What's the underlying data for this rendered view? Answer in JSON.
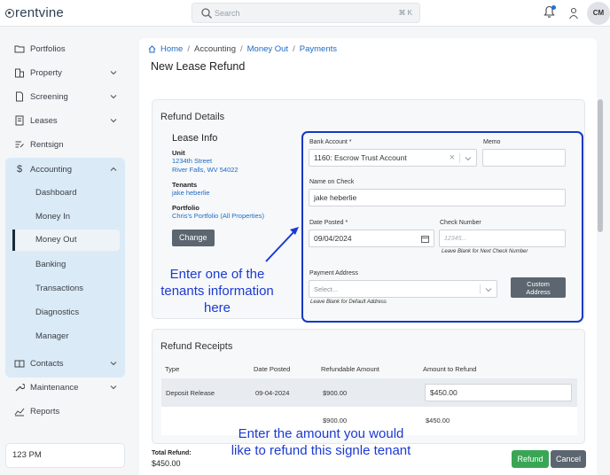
{
  "app": {
    "logo": "rentvine",
    "user_initials": "CM"
  },
  "search": {
    "placeholder": "Search",
    "shortcut": "⌘ K"
  },
  "sidebar": {
    "items": [
      {
        "label": "Portfolios",
        "icon": "folder-icon"
      },
      {
        "label": "Property",
        "icon": "building-icon"
      },
      {
        "label": "Screening",
        "icon": "document-icon"
      },
      {
        "label": "Leases",
        "icon": "lease-icon"
      },
      {
        "label": "Rentsign",
        "icon": "signature-icon"
      },
      {
        "label": "Accounting",
        "icon": "dollar-icon"
      }
    ],
    "accounting_sub": [
      "Dashboard",
      "Money In",
      "Money Out",
      "Banking",
      "Transactions",
      "Diagnostics",
      "Manager"
    ],
    "lower_items": [
      {
        "label": "Contacts",
        "icon": "contacts-icon"
      },
      {
        "label": "Maintenance",
        "icon": "wrench-icon"
      },
      {
        "label": "Reports",
        "icon": "chart-icon"
      }
    ],
    "clock": "123 PM"
  },
  "breadcrumb": {
    "home": "Home",
    "accounting": "Accounting",
    "money_out": "Money Out",
    "payments": "Payments"
  },
  "page_title": "New Lease Refund",
  "refund_details": {
    "title": "Refund Details",
    "lease_info": {
      "heading": "Lease Info",
      "unit_label": "Unit",
      "unit_line1": "1234th Street",
      "unit_line2": "River Falls, WV 54022",
      "tenants_label": "Tenants",
      "tenant": "jake heberlie",
      "portfolio_label": "Portfolio",
      "portfolio": "Chris's Portfolio (All Properties)",
      "change_button": "Change"
    },
    "form": {
      "bank_account_label": "Bank Account *",
      "bank_account_value": "1160: Escrow Trust Account",
      "memo_label": "Memo",
      "memo_value": "",
      "name_on_check_label": "Name on Check",
      "name_on_check_value": "jake heberlie",
      "date_posted_label": "Date Posted *",
      "date_posted_value": "09/04/2024",
      "check_number_label": "Check Number",
      "check_number_placeholder": "12345...",
      "check_number_hint": "Leave Blank for Next Check Number",
      "payment_address_label": "Payment Address",
      "payment_address_placeholder": "Select...",
      "payment_address_hint": "Leave Blank for Default Address",
      "custom_address_line1": "Custom",
      "custom_address_line2": "Address"
    }
  },
  "refund_receipts": {
    "title": "Refund Receipts",
    "columns": [
      "Type",
      "Date Posted",
      "Refundable Amount",
      "Amount to Refund"
    ],
    "rows": [
      {
        "type": "Deposit Release",
        "date": "09-04-2024",
        "refundable": "$900.00",
        "amount": "$450.00"
      }
    ],
    "totals": {
      "refundable": "$900.00",
      "amount": "$450.00"
    }
  },
  "footer": {
    "total_label": "Total Refund:",
    "total_value": "$450.00",
    "refund_button": "Refund",
    "cancel_button": "Cancel"
  },
  "annotations": {
    "tenant_note_line1": "Enter one of the",
    "tenant_note_line2": "tenants information",
    "tenant_note_line3": "here",
    "amount_note_line1": "Enter the amount you would",
    "amount_note_line2": "like to refund this signle tenant"
  },
  "colors": {
    "accent": "#1e6bc4",
    "annotation": "#1b3ad2",
    "refund_green": "#3aa655",
    "sidebar_active": "#dbeaf7"
  }
}
